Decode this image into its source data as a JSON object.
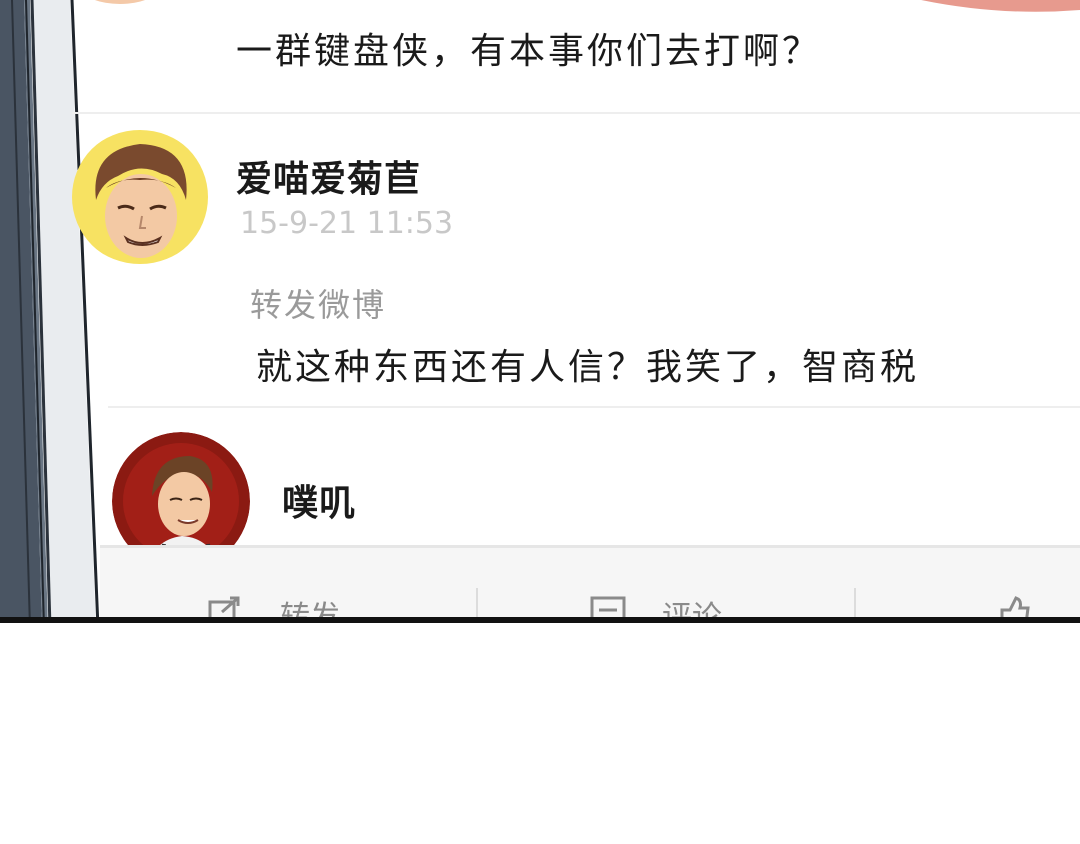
{
  "comments": [
    {
      "text": "一群键盘侠，有本事你们去打啊？"
    },
    {
      "username": "爱喵爱菊苣",
      "timestamp": "15-9-21 11:53",
      "tag": "转发微博",
      "text": "就这种东西还有人信？我笑了，智商税"
    },
    {
      "username": "噗叽"
    }
  ],
  "action_bar": {
    "repost_label": "转发",
    "comment_label": "评论",
    "like_label": ""
  },
  "colors": {
    "timestamp": "#c8c8c8",
    "repost_tag": "#9a9a9a",
    "panel_border": "#111111",
    "avatar2_bg": "#8b1a12"
  }
}
